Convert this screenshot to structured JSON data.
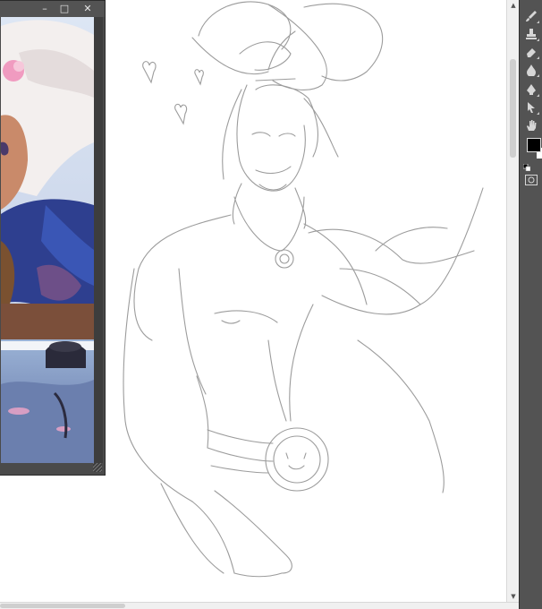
{
  "reference_window": {
    "title": "",
    "minimize_label": "–",
    "maximize_label": "□",
    "close_label": "✕"
  },
  "tools": [
    {
      "name": "brush-tool-icon"
    },
    {
      "name": "clone-stamp-icon"
    },
    {
      "name": "eraser-icon"
    },
    {
      "name": "blur-tool-icon"
    },
    {
      "name": "pen-tool-icon"
    },
    {
      "name": "path-selection-icon"
    },
    {
      "name": "hand-tool-icon"
    }
  ],
  "colors": {
    "foreground": "#000000",
    "background": "#ffffff",
    "panel": "#535353",
    "canvas": "#ffffff",
    "sketch_line": "#9a9a9a"
  },
  "icons": [
    "swap-colors-icon",
    "quick-mask-icon",
    "scroll-up-icon",
    "scroll-down-icon",
    "resize-grip-icon"
  ]
}
